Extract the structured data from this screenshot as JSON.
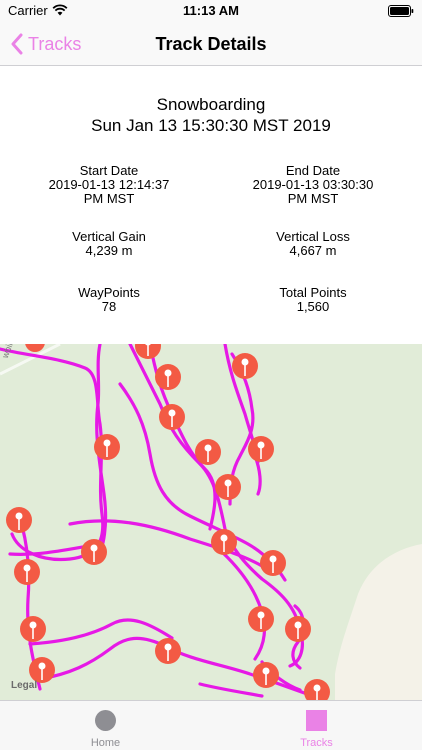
{
  "status": {
    "carrier": "Carrier",
    "time": "11:13 AM"
  },
  "nav": {
    "back_label": "Tracks",
    "title": "Track Details"
  },
  "summary": {
    "activity": "Snowboarding",
    "date": "Sun Jan 13 15:30:30 MST 2019",
    "stats": {
      "start": {
        "label": "Start Date",
        "value": "2019-01-13 12:14:37",
        "value2": "PM MST"
      },
      "end": {
        "label": "End Date",
        "value": "2019-01-13 03:30:30",
        "value2": "PM MST"
      },
      "gain": {
        "label": "Vertical Gain",
        "value": "4,239 m"
      },
      "loss": {
        "label": "Vertical Loss",
        "value": "4,667 m"
      },
      "waypoints": {
        "label": "WayPoints",
        "value": "78"
      },
      "points": {
        "label": "Total Points",
        "value": "1,560"
      }
    }
  },
  "map": {
    "legal": "Legal",
    "road": "wbird Rd",
    "track_color": "#e619e6",
    "pin_color": "#f35a44"
  },
  "tabs": [
    {
      "label": "Home",
      "color": "#8e8e93"
    },
    {
      "label": "Tracks",
      "color": "#ea82e6"
    }
  ]
}
